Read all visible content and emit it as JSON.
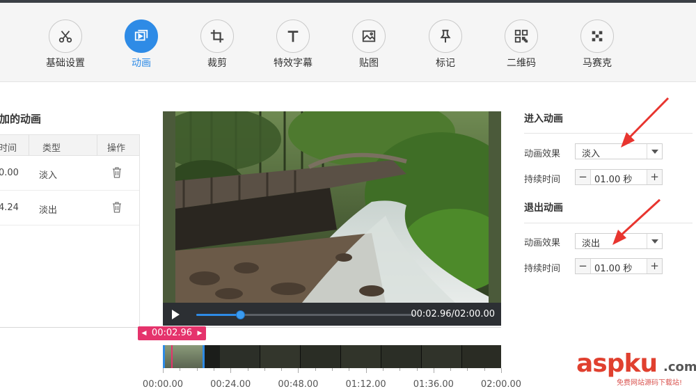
{
  "toolbar": {
    "items": [
      {
        "label": "基础设置",
        "icon": "scissors-icon"
      },
      {
        "label": "动画",
        "icon": "animation-icon",
        "active": true
      },
      {
        "label": "裁剪",
        "icon": "crop-icon"
      },
      {
        "label": "特效字幕",
        "icon": "text-icon"
      },
      {
        "label": "贴图",
        "icon": "image-icon"
      },
      {
        "label": "标记",
        "icon": "pin-icon"
      },
      {
        "label": "二维码",
        "icon": "qrcode-icon"
      },
      {
        "label": "马赛克",
        "icon": "mosaic-icon"
      }
    ],
    "active_color": "#2e8be6"
  },
  "left_panel": {
    "title": "加的动画",
    "columns": [
      "时间",
      "类型",
      "操作"
    ],
    "rows": [
      {
        "time": "0.00",
        "type": "淡入",
        "action_icon": "trash-icon"
      },
      {
        "time": "4.24",
        "type": "淡出",
        "action_icon": "trash-icon"
      }
    ]
  },
  "player": {
    "time_readout": "00:02.96/02:00.00",
    "progress": 0.2
  },
  "timeline": {
    "current_time": "00:02.96",
    "labels": [
      "00:00.00",
      "00:24.00",
      "00:48.00",
      "01:12.00",
      "01:36.00",
      "02:00.00"
    ],
    "cursor_color": "#e5336c"
  },
  "enter_animation": {
    "title": "进入动画",
    "effect_label": "动画效果",
    "effect_value": "淡入",
    "duration_label": "持续时间",
    "duration_value": "01.00 秒"
  },
  "exit_animation": {
    "title": "退出动画",
    "effect_label": "动画效果",
    "effect_value": "淡出",
    "duration_label": "持续时间",
    "duration_value": "01.00 秒"
  },
  "watermark": {
    "brand_a": "asp",
    "brand_b": "ku",
    "brand_c": ".com",
    "tagline": "免费网站源码下载站!"
  }
}
